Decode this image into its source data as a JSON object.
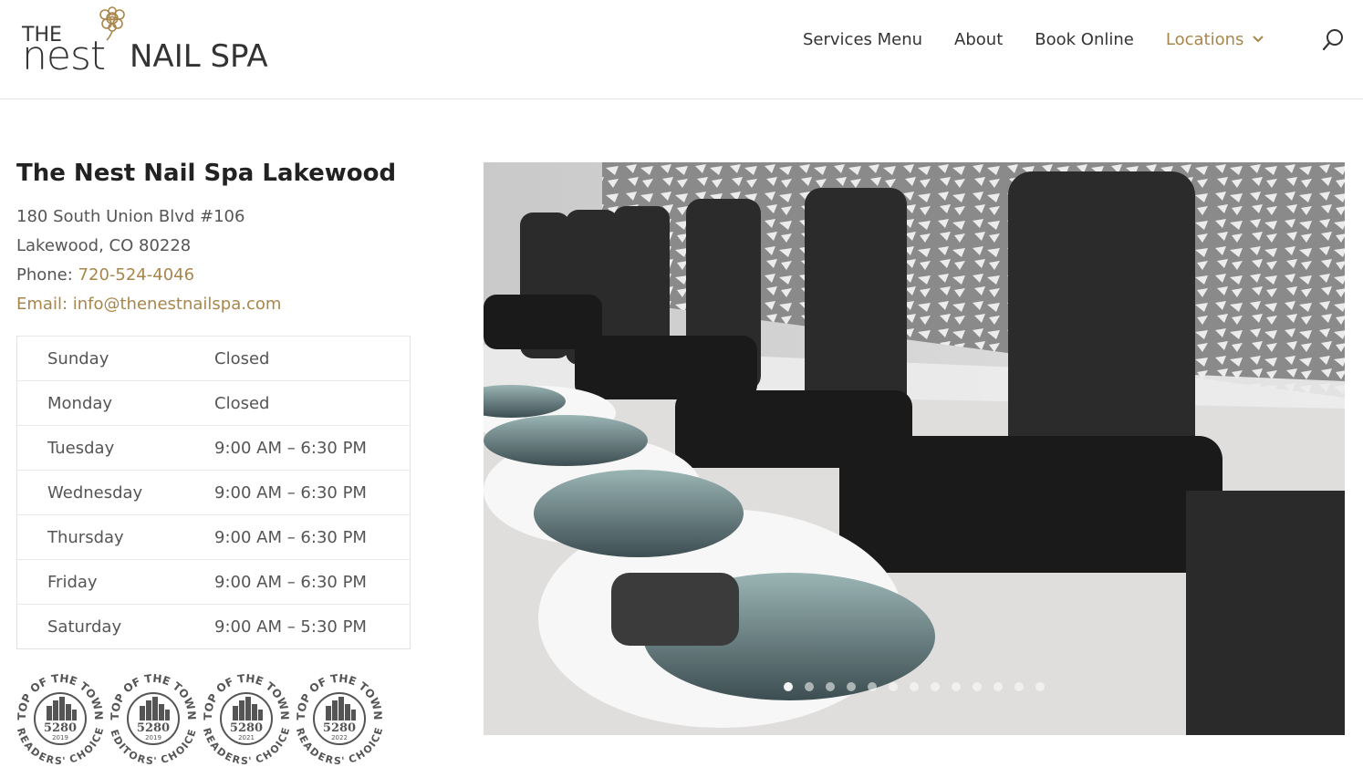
{
  "brand": {
    "the": "THE",
    "nest": "nest",
    "nail_spa": "NAIL SPA",
    "accent": "#a8864b"
  },
  "nav": {
    "items": [
      {
        "label": "Services Menu"
      },
      {
        "label": "About"
      },
      {
        "label": "Book Online"
      },
      {
        "label": "Locations",
        "active": true
      }
    ],
    "search_icon": "search-icon"
  },
  "location": {
    "title": "The Nest Nail Spa Lakewood",
    "address1": "180 South Union Blvd #106",
    "address2": "Lakewood, CO 80228",
    "phone_label": "Phone: ",
    "phone": "720-524-4046",
    "email_label": "Email: ",
    "email": "info@thenestnailspa.com"
  },
  "hours": [
    {
      "day": "Sunday",
      "time": "Closed"
    },
    {
      "day": "Monday",
      "time": "Closed"
    },
    {
      "day": "Tuesday",
      "time": "9:00 AM – 6:30 PM"
    },
    {
      "day": "Wednesday",
      "time": "9:00 AM – 6:30 PM"
    },
    {
      "day": "Thursday",
      "time": "9:00 AM – 6:30 PM"
    },
    {
      "day": "Friday",
      "time": "9:00 AM – 6:30 PM"
    },
    {
      "day": "Saturday",
      "time": "9:00 AM – 5:30 PM"
    }
  ],
  "badges": [
    {
      "top": "TOP OF THE TOWN",
      "num": "5280",
      "year": "2019",
      "bottom": "READERS' CHOICE"
    },
    {
      "top": "TOP OF THE TOWN",
      "num": "5280",
      "year": "2019",
      "bottom": "EDITORS' CHOICE"
    },
    {
      "top": "TOP OF THE TOWN",
      "num": "5280",
      "year": "2021",
      "bottom": "READERS' CHOICE"
    },
    {
      "top": "TOP OF THE TOWN",
      "num": "5280",
      "year": "2022",
      "bottom": "READERS' CHOICE"
    }
  ],
  "slider": {
    "image": "pedicure-chairs-photo",
    "slides": 13,
    "active": 0
  }
}
